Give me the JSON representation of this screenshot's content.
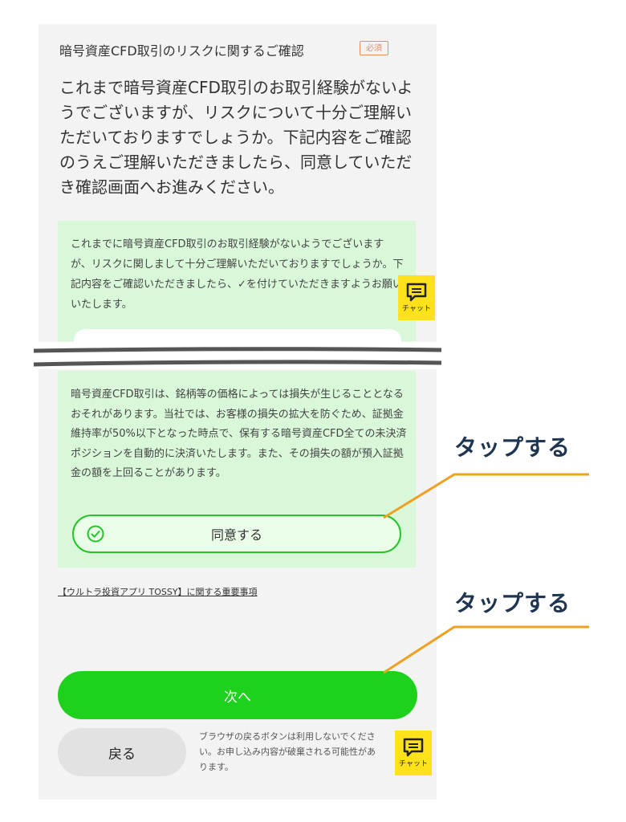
{
  "confirmation": {
    "title": "暗号資産CFD取引のリスクに関するご確認",
    "required_badge": "必須",
    "intro": "これまで暗号資産CFD取引のお取引経験がないようでございますが、リスクについて十分ご理解いただいておりますでしょうか。下記内容をご確認のうえご理解いただきましたら、同意していただき確認画面へお進みください。"
  },
  "panel": {
    "instruction": "これまでに暗号資産CFD取引のお取引経験がないようでございますが、リスクに関しまして十分ご理解いただいておりますでしょうか。下記内容をご確認いただきましたら、✓を付けていただきますようお願いいたします。",
    "risk_text": "暗号資産CFD取引は、銘柄等の価格によっては損失が生じることとなるおそれがあります。当社では、お客様の損失の拡大を防ぐため、証拠金維持率が50%以下となった時点で、保有する暗号資産CFD全ての未決済ポジションを自動的に決済いたします。また、その損失の額が預入証拠金の額を上回ることがあります。",
    "agree_label": "同意する"
  },
  "links": {
    "important_matters": "【ウルトラ投資アプリ TOSSY】に関する重要事項"
  },
  "buttons": {
    "next": "次へ",
    "back": "戻る"
  },
  "browser_note": "ブラウザの戻るボタンは利用しないでください。お申し込み内容が破棄される可能性があります。",
  "chat": {
    "label": "チャット"
  },
  "annotations": {
    "tap_1": "タップする",
    "tap_2": "タップする"
  },
  "colors": {
    "accent_green": "#1dd11d",
    "panel_green": "#d9f7d9",
    "chat_yellow": "#ffe21a",
    "callout_orange": "#f0a020",
    "callout_text": "#1f3550",
    "badge_orange": "#f08a5d"
  },
  "icons": {
    "chat": "chat-bubble-icon",
    "agree": "check-circle-icon"
  }
}
